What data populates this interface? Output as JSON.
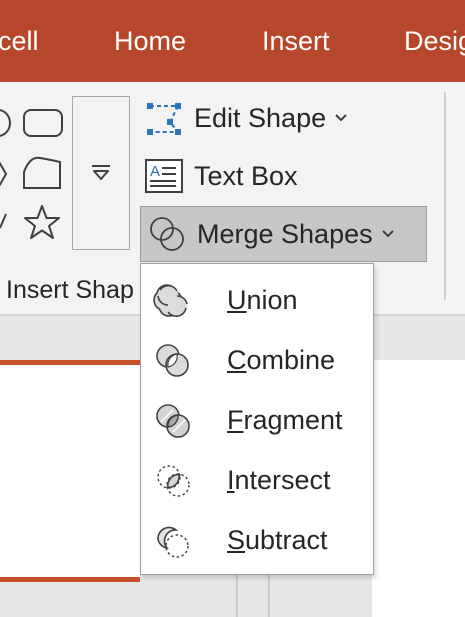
{
  "tabs": [
    {
      "label": "cell"
    },
    {
      "label": "Home"
    },
    {
      "label": "Insert"
    },
    {
      "label": "Desig"
    }
  ],
  "ribbon": {
    "edit_shape_label": "Edit Shape",
    "text_box_label": "Text Box",
    "merge_shapes_label": "Merge Shapes",
    "insert_shapes_group_label": "Insert Shap"
  },
  "merge_menu": {
    "items": [
      {
        "first": "U",
        "rest": "nion",
        "icon": "union-icon"
      },
      {
        "first": "C",
        "rest": "ombine",
        "icon": "combine-icon"
      },
      {
        "first": "F",
        "rest": "ragment",
        "icon": "fragment-icon"
      },
      {
        "first": "I",
        "rest": "ntersect",
        "icon": "intersect-icon"
      },
      {
        "first": "S",
        "rest": "ubtract",
        "icon": "subtract-icon"
      }
    ]
  },
  "colors": {
    "accent": "#b7472a",
    "ribbon": "#f3f3f3",
    "pressed_button": "#c7c7c7"
  }
}
